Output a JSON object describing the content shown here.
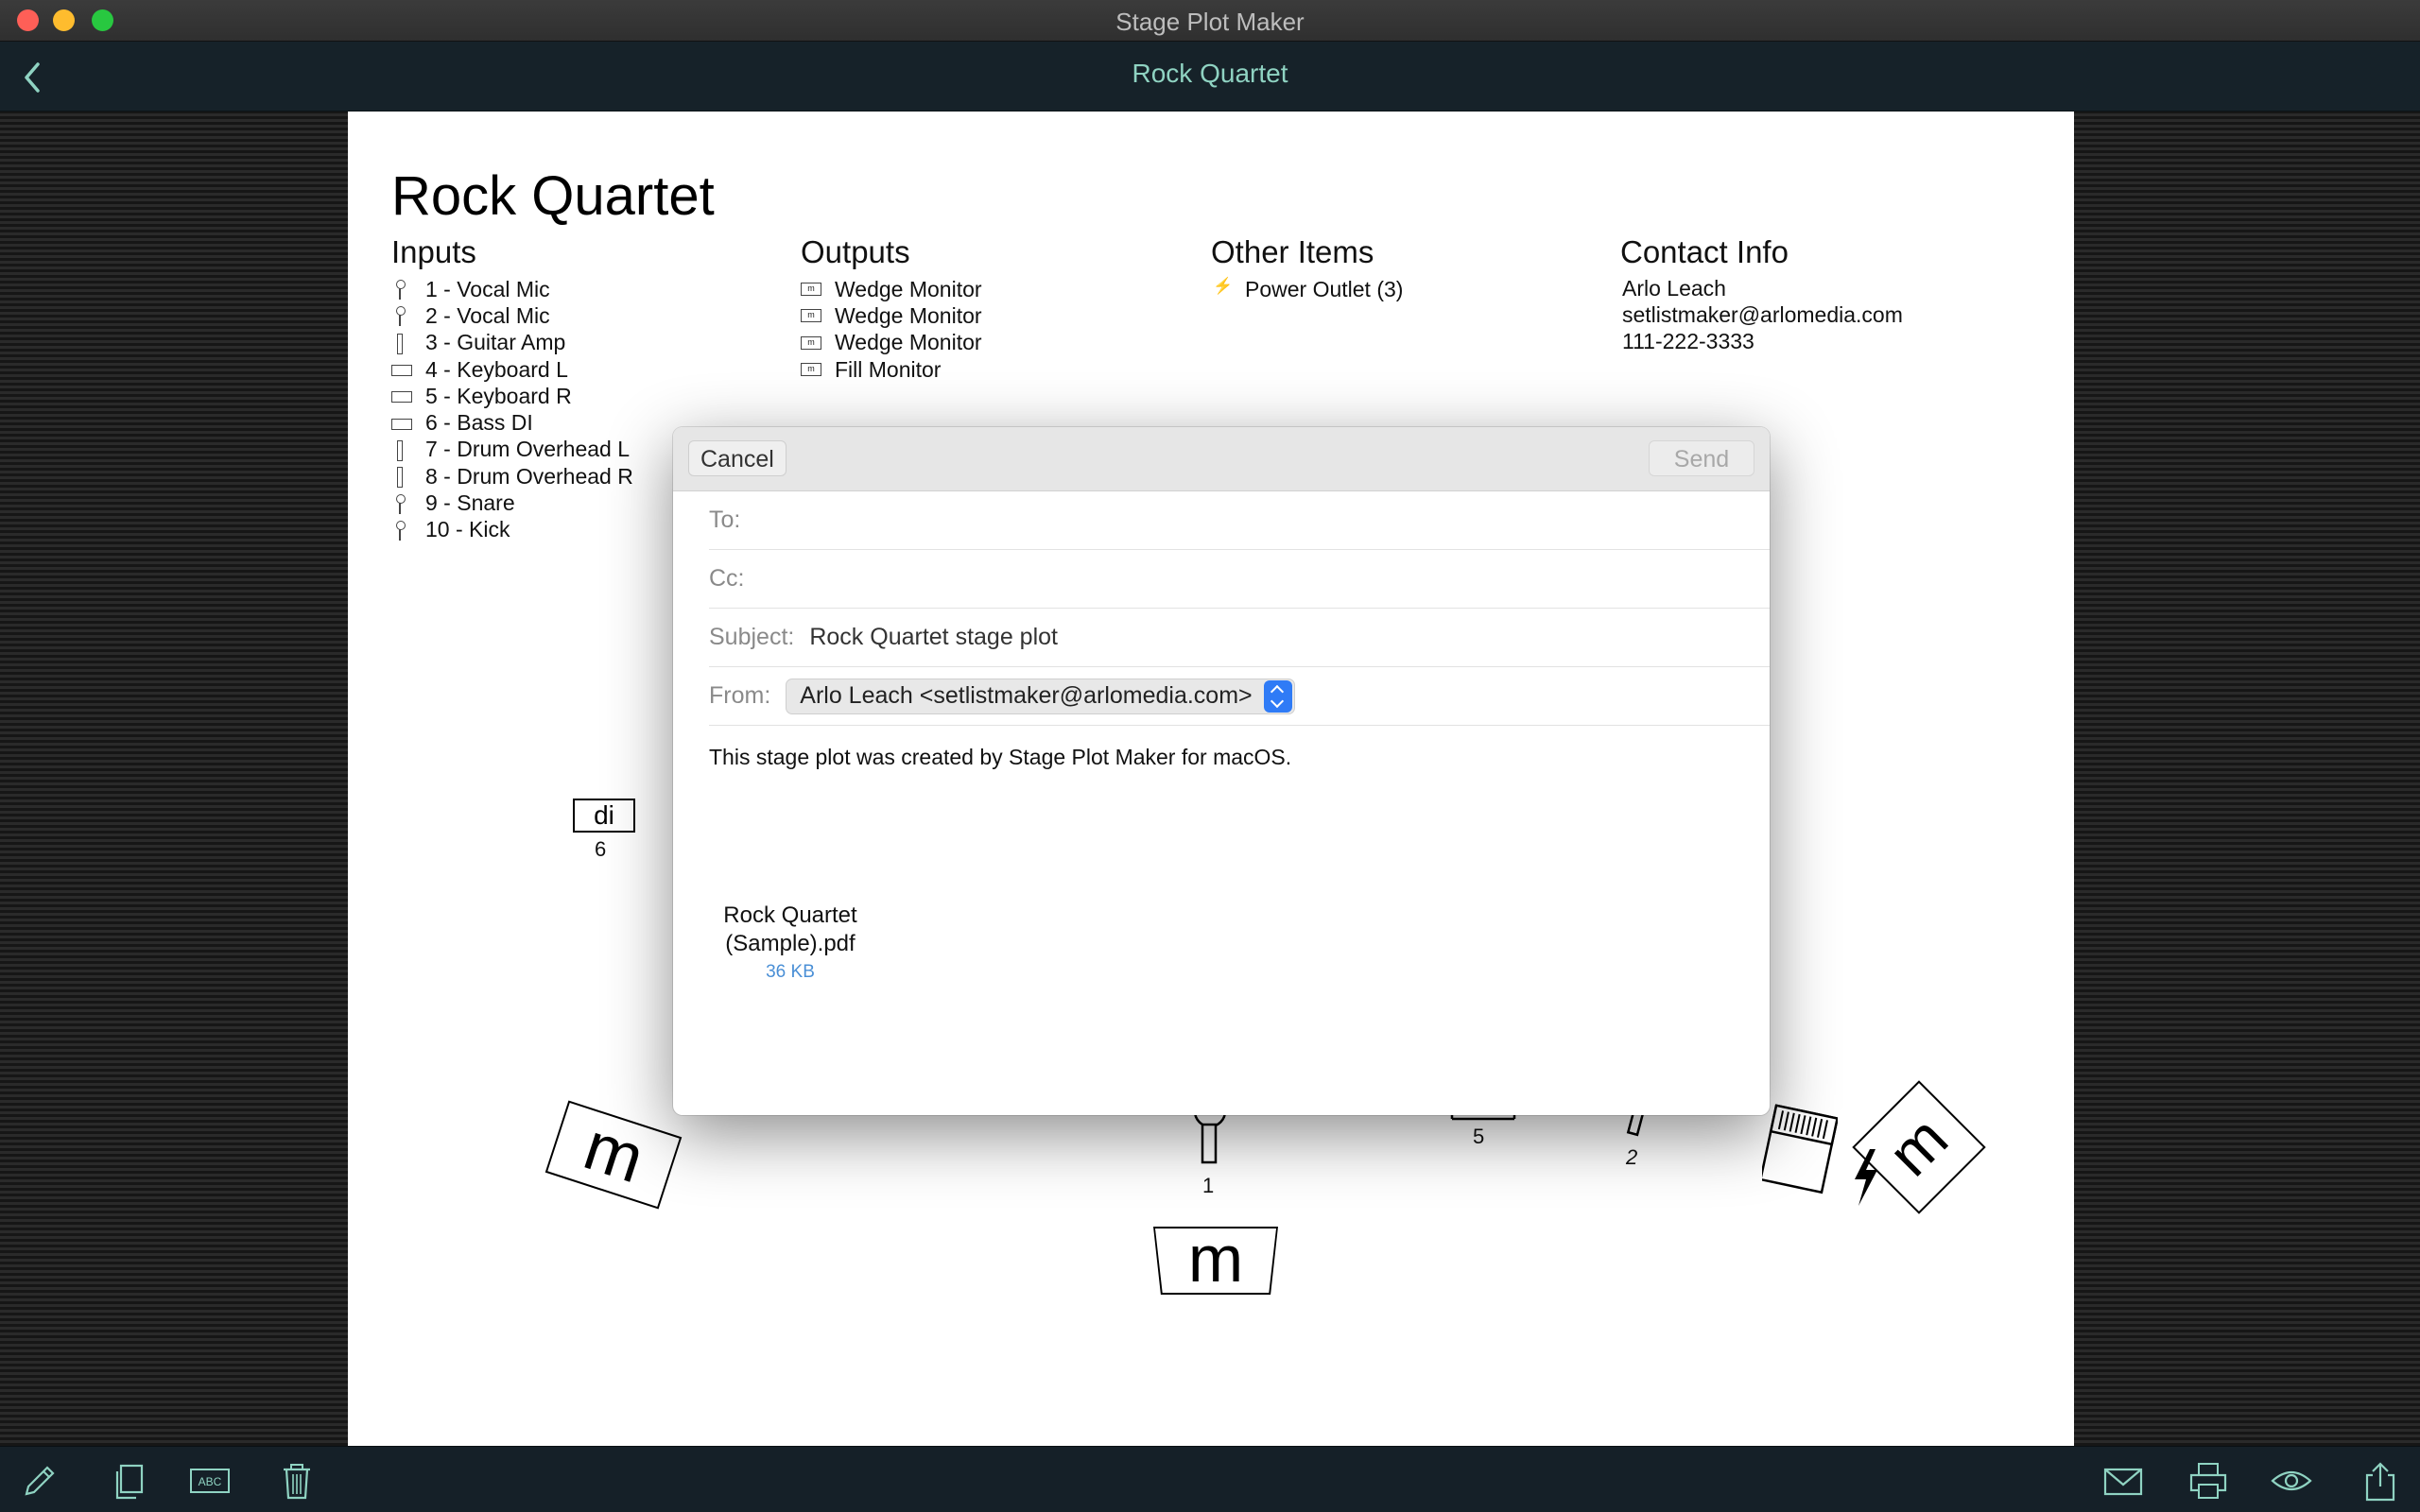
{
  "window": {
    "title": "Stage Plot Maker"
  },
  "nav": {
    "title": "Rock Quartet"
  },
  "plot": {
    "title": "Rock Quartet",
    "inputs": {
      "heading": "Inputs",
      "items": [
        {
          "label": "1 - Vocal Mic",
          "icon": "mic-icon"
        },
        {
          "label": "2 - Vocal Mic",
          "icon": "mic-icon"
        },
        {
          "label": "3 - Guitar Amp",
          "icon": "amp-mic-icon"
        },
        {
          "label": "4 - Keyboard L",
          "icon": "di-icon"
        },
        {
          "label": "5 - Keyboard R",
          "icon": "di-icon"
        },
        {
          "label": "6 - Bass DI",
          "icon": "di-icon"
        },
        {
          "label": "7 - Drum Overhead L",
          "icon": "amp-mic-icon"
        },
        {
          "label": "8 - Drum Overhead R",
          "icon": "amp-mic-icon"
        },
        {
          "label": "9 - Snare",
          "icon": "snare-mic-icon"
        },
        {
          "label": "10 - Kick",
          "icon": "kick-mic-icon"
        }
      ]
    },
    "outputs": {
      "heading": "Outputs",
      "items": [
        {
          "label": "Wedge Monitor",
          "icon": "monitor-icon"
        },
        {
          "label": "Wedge Monitor",
          "icon": "monitor-icon"
        },
        {
          "label": "Wedge Monitor",
          "icon": "monitor-icon"
        },
        {
          "label": "Fill Monitor",
          "icon": "monitor-icon"
        }
      ]
    },
    "other": {
      "heading": "Other Items",
      "items": [
        {
          "label": "Power Outlet (3)",
          "icon": "bolt-icon"
        }
      ]
    },
    "contact": {
      "heading": "Contact Info",
      "name": "Arlo Leach",
      "email": "setlistmaker@arlomedia.com",
      "phone": "111-222-3333"
    },
    "stage": {
      "di_label": "di",
      "di_number": "6",
      "monitor_label": "m",
      "mic1_number": "1",
      "keyboard_number": "5",
      "mic2_number": "2"
    }
  },
  "mail": {
    "cancel_label": "Cancel",
    "send_label": "Send",
    "to_label": "To:",
    "to_value": "",
    "cc_label": "Cc:",
    "cc_value": "",
    "subject_label": "Subject:",
    "subject_value": "Rock Quartet stage plot",
    "from_label": "From:",
    "from_value": "Arlo Leach <setlistmaker@arlomedia.com>",
    "body": "This stage plot was created by Stage Plot Maker for macOS.",
    "attachment": {
      "name_line1": "Rock Quartet",
      "name_line2": "(Sample).pdf",
      "size": "36 KB"
    }
  },
  "toolbar": {
    "left": [
      "pencil-icon",
      "duplicate-icon",
      "text-label-icon",
      "trash-icon"
    ],
    "right": [
      "mail-icon",
      "print-icon",
      "preview-icon",
      "share-icon"
    ]
  },
  "colors": {
    "accent": "#8fd3c2",
    "nav_bg": "#162229",
    "send_blue": "#2f7bf6"
  }
}
